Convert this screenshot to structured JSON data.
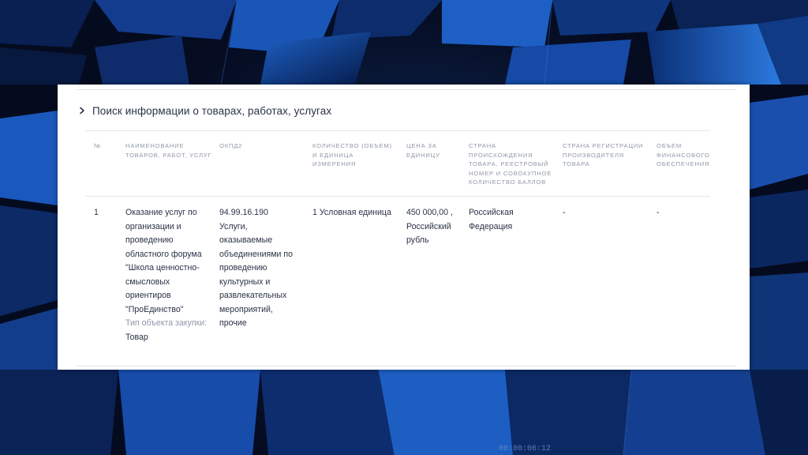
{
  "section": {
    "title": "Поиск информации о товарах, работах, услугах"
  },
  "table": {
    "headers": {
      "num": "№",
      "name": "Наименование товаров, работ, услуг",
      "okpd": "ОКПД2",
      "qty": "Количество (объем) и единица измерения",
      "price": "Цена за единицу",
      "country": "Страна происхождения товара, реестровый номер и совокупное количество баллов",
      "regcountry": "Страна регистрации производителя товара",
      "finance": "Объем финансового обеспечения"
    },
    "rows": [
      {
        "num": "1",
        "name": "Оказание услуг по организации и проведению областного форума \"Школа ценностно-смысловых ориентиров \"ПроЕдинство\"",
        "object_type_label": "Тип объекта закупки:",
        "object_type_value": "Товар",
        "okpd_code": "94.99.16.190",
        "okpd_desc": "Услуги, оказываемые объединениями по проведению культурных и развлекательных мероприятий, прочие",
        "qty": "1 Условная единица",
        "price": "450 000,00 , Российский рубль",
        "country": "Российская Федерация",
        "regcountry": "-",
        "finance": "-"
      }
    ]
  },
  "background": {
    "timestamp": "00:00:06:12"
  }
}
